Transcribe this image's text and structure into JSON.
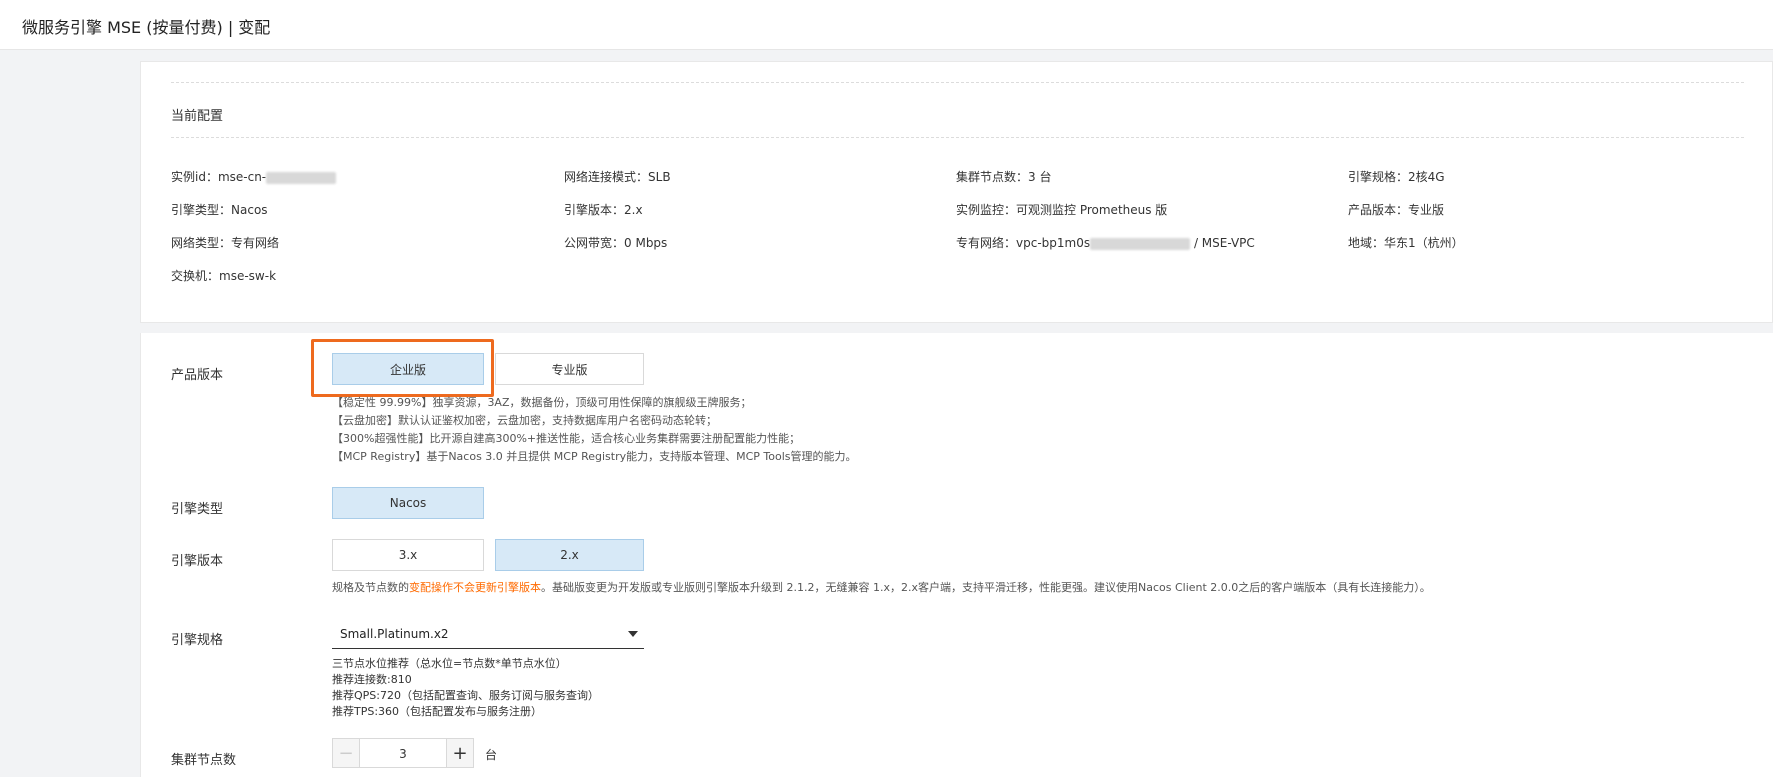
{
  "header": {
    "title": "微服务引擎 MSE (按量付费) | 变配"
  },
  "current_config": {
    "title": "当前配置",
    "items": [
      {
        "label": "实例id：",
        "value": "mse-cn-"
      },
      {
        "label": "网络连接模式：",
        "value": "SLB"
      },
      {
        "label": "集群节点数：",
        "value": "3 台"
      },
      {
        "label": "引擎规格：",
        "value": "2核4G"
      },
      {
        "label": "引擎类型：",
        "value": "Nacos"
      },
      {
        "label": "引擎版本：",
        "value": "2.x"
      },
      {
        "label": "实例监控：",
        "value": "可观测监控 Prometheus 版"
      },
      {
        "label": "产品版本：",
        "value": "专业版"
      },
      {
        "label": "网络类型：",
        "value": "专有网络"
      },
      {
        "label": "公网带宽：",
        "value": "0 Mbps"
      },
      {
        "label": "专有网络：",
        "value": "vpc-bp1m0s",
        "suffix": "/ MSE-VPC"
      },
      {
        "label": "地域：",
        "value": "华东1（杭州）"
      },
      {
        "label": "交换机：",
        "value": "mse-sw-k"
      }
    ]
  },
  "form": {
    "product_version": {
      "label": "产品版本",
      "options": [
        "企业版",
        "专业版"
      ],
      "selected": "企业版",
      "desc": [
        "【稳定性 99.99%】独享资源，3AZ，数据备份，顶级可用性保障的旗舰级王牌服务；",
        "【云盘加密】默认认证鉴权加密，云盘加密，支持数据库用户名密码动态轮转；",
        "【300%超强性能】比开源自建高300%+推送性能，适合核心业务集群需要注册配置能力性能；",
        "【MCP Registry】基于Nacos 3.0 并且提供 MCP Registry能力，支持版本管理、MCP Tools管理的能力。"
      ]
    },
    "engine_type": {
      "label": "引擎类型",
      "options": [
        "Nacos"
      ],
      "selected": "Nacos"
    },
    "engine_version": {
      "label": "引擎版本",
      "options": [
        "3.x",
        "2.x"
      ],
      "selected": "2.x",
      "note_prefix": "规格及节点数的",
      "note_warn": "变配操作不会更新引擎版本",
      "note_suffix": "。基础版变更为开发版或专业版则引擎版本升级到 2.1.2，无缝兼容 1.x，2.x客户端，支持平滑迁移，性能更强。建议使用Nacos Client 2.0.0之后的客户端版本（具有长连接能力）。"
    },
    "engine_spec": {
      "label": "引擎规格",
      "value": "Small.Platinum.x2",
      "desc": [
        "三节点水位推荐（总水位=节点数*单节点水位）",
        "推荐连接数:810",
        "推荐QPS:720（包括配置查询、服务订阅与服务查询）",
        "推荐TPS:360（包括配置发布与服务注册）"
      ]
    },
    "node_count": {
      "label": "集群节点数",
      "value": "3",
      "unit": "台",
      "minus": "−",
      "plus": "+"
    }
  }
}
